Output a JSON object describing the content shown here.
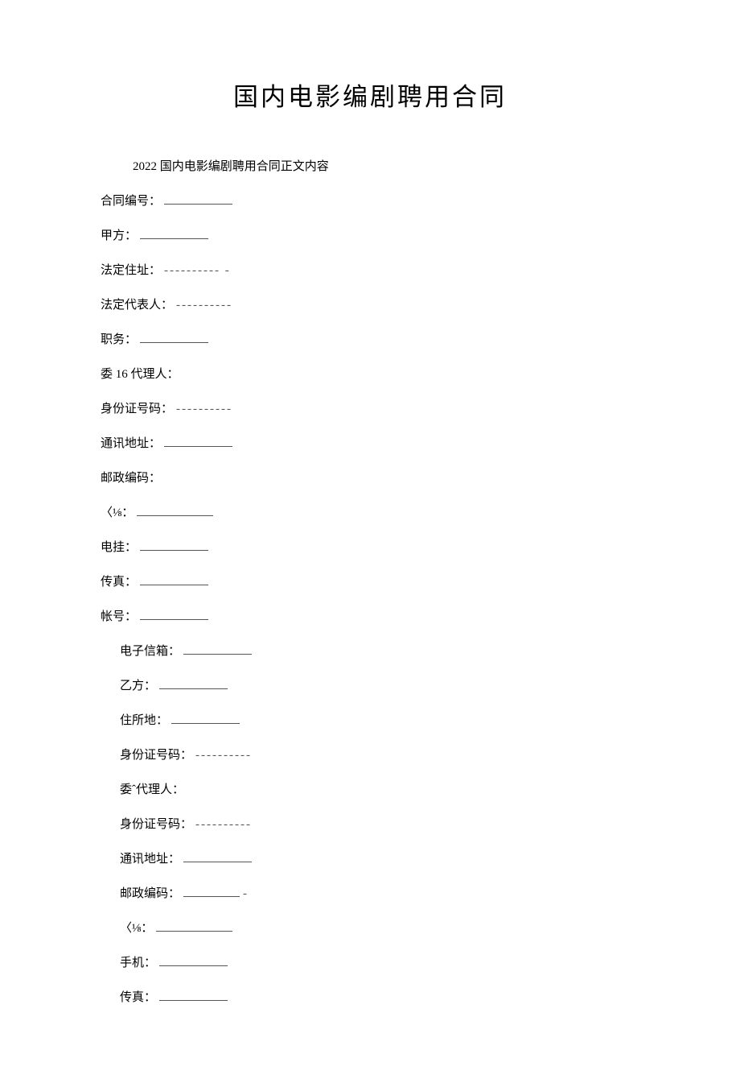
{
  "title": "国内电影编剧聘用合同",
  "subtitle": "2022 国内电影编剧聘用合同正文内容",
  "fields": {
    "contract_no": "合同编号：",
    "party_a": "甲方：",
    "legal_address": "法定住址：",
    "legal_rep": "法定代表人：",
    "position": "职务：",
    "agent_16": "委 16 代理人：",
    "id_number": "身份证号码：",
    "contact_address": "通讯地址：",
    "postal_code": "邮政编码：",
    "fraction": "〈⅛：",
    "telegraph": "电挂：",
    "fax": "传真：",
    "account": "帐号：",
    "email": "电子信箱：",
    "party_b": "乙方：",
    "residence": "住所地：",
    "id_number_b": "身份证号码：",
    "agent_b": "委ˆ代理人：",
    "id_number_b2": "身份证号码：",
    "contact_address_b": "通讯地址：",
    "postal_code_b": "邮政编码：",
    "fraction_b": "〈⅛：",
    "mobile": "手机：",
    "fax_b": "传真："
  },
  "dashes": {
    "legal_address": "---------- -",
    "legal_rep": "----------",
    "id_number": "----------",
    "id_number_b": "----------",
    "id_number_b2": "----------",
    "postal_code_b_suffix": "-"
  }
}
